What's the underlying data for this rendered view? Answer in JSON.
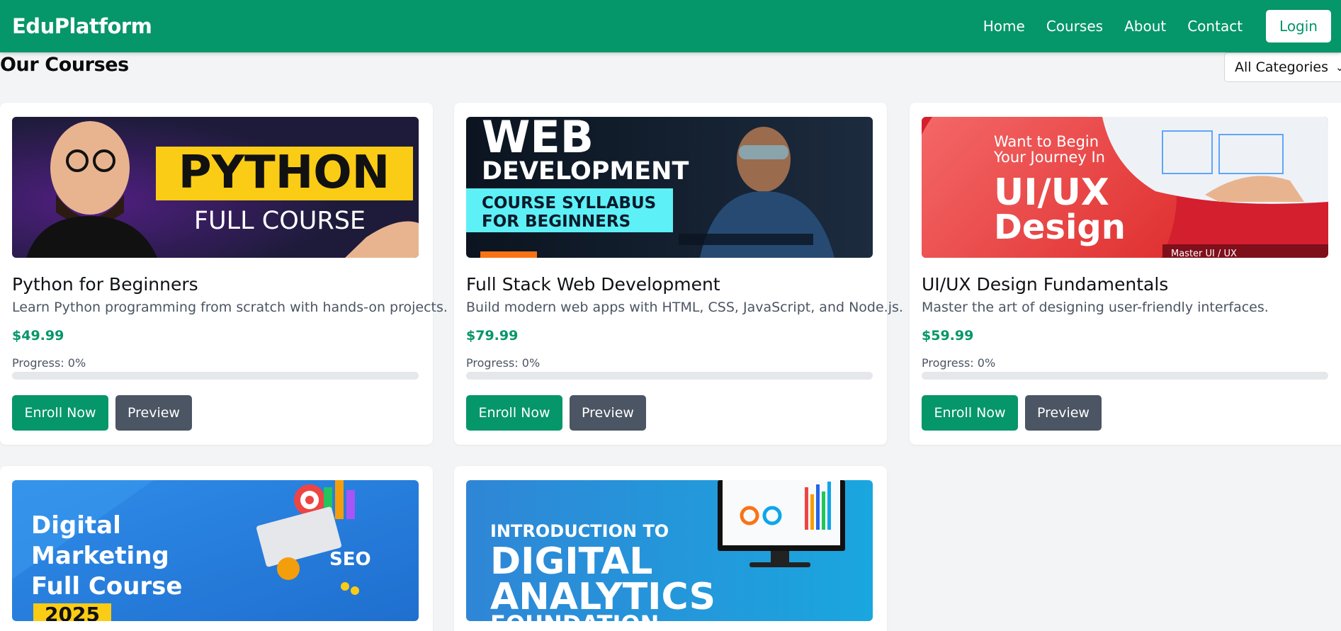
{
  "navbar": {
    "brand": "EduPlatform",
    "links": [
      "Home",
      "Courses",
      "About",
      "Contact"
    ],
    "login_label": "Login",
    "color": "#059669"
  },
  "page": {
    "title": "Our Courses",
    "category_filter": "All Categories"
  },
  "courses": [
    {
      "title": "Python for Beginners",
      "description": "Learn Python programming from scratch with hands-on projects.",
      "price": "$49.99",
      "progress_label": "Progress: 0%",
      "progress": 0,
      "enroll_label": "Enroll Now",
      "preview_label": "Preview",
      "thumb_text": [
        "PYTHON",
        "FULL COURSE"
      ]
    },
    {
      "title": "Full Stack Web Development",
      "description": "Build modern web apps with HTML, CSS, JavaScript, and Node.js.",
      "price": "$79.99",
      "progress_label": "Progress: 0%",
      "progress": 0,
      "enroll_label": "Enroll Now",
      "preview_label": "Preview",
      "thumb_text": [
        "WEB",
        "DEVELOPMENT",
        "COURSE SYLLABUS",
        "FOR BEGINNERS"
      ]
    },
    {
      "title": "UI/UX Design Fundamentals",
      "description": "Master the art of designing user-friendly interfaces.",
      "price": "$59.99",
      "progress_label": "Progress: 0%",
      "progress": 0,
      "enroll_label": "Enroll Now",
      "preview_label": "Preview",
      "thumb_text": [
        "Want to Begin",
        "Your Journey In",
        "UI/UX",
        "Design",
        "Master UI / UX"
      ]
    },
    {
      "thumb_text": [
        "Digital",
        "Marketing",
        "Full Course",
        "2025"
      ]
    },
    {
      "thumb_text": [
        "INTRODUCTION TO",
        "DIGITAL",
        "ANALYTICS",
        "FOUNDATION"
      ]
    }
  ]
}
